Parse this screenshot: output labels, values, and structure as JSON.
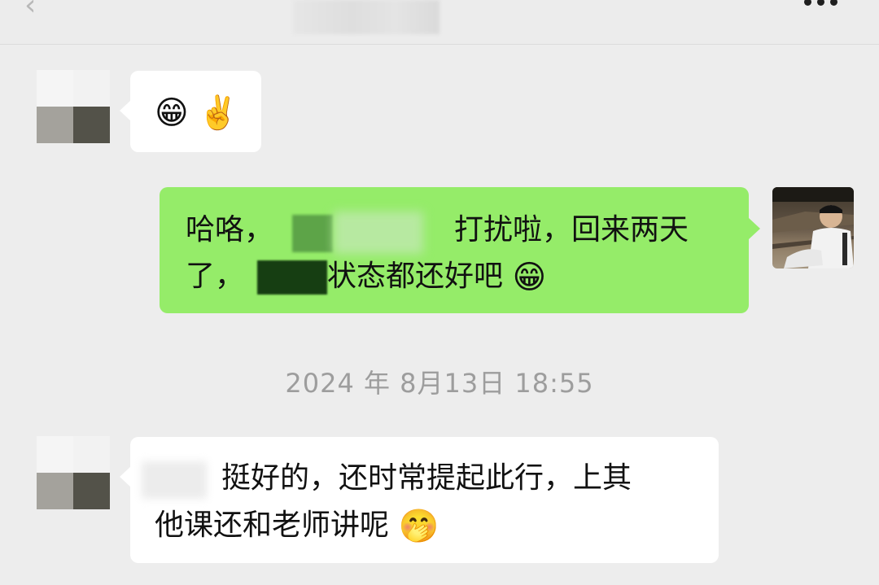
{
  "header": {
    "back_glyph": "‹",
    "more_icon": "more-icon"
  },
  "messages": [
    {
      "side": "in",
      "emojis": [
        "😁",
        "✌️"
      ]
    },
    {
      "side": "out",
      "line1_start": "哈咯，",
      "line1_end": "打扰啦，回来两天",
      "line2_start": "了，",
      "line2_end": "状态都还好吧",
      "emoji": "😁"
    },
    {
      "side": "in",
      "line1": "挺好的，还时常提起此行，上其",
      "line2": "他课还和老师讲呢",
      "emoji": "🤭"
    }
  ],
  "timestamp": "2024 年 8月13日 18:55",
  "colors": {
    "background": "#ededed",
    "incoming_bubble": "#ffffff",
    "outgoing_bubble": "#95ec69",
    "timestamp_text": "#9d9d9d"
  }
}
